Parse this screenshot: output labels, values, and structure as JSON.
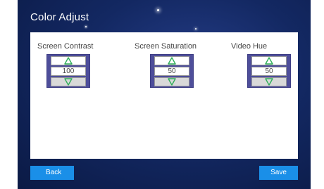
{
  "title": "Color Adjust",
  "controls": [
    {
      "label": "Screen Contrast",
      "value": "100",
      "up_icon": "chevron-up-outline-icon",
      "down_icon": "chevron-down-outline-icon"
    },
    {
      "label": "Screen Saturation",
      "value": "50",
      "up_icon": "chevron-up-outline-icon",
      "down_icon": "chevron-down-outline-icon"
    },
    {
      "label": "Video Hue",
      "value": "50",
      "up_icon": "chevron-up-outline-icon",
      "down_icon": "chevron-down-outline-icon"
    }
  ],
  "footer": {
    "back_label": "Back",
    "save_label": "Save"
  },
  "colors": {
    "background": "#132862",
    "spinner_frame": "#4e4e9a",
    "arrow": "#2fae5a",
    "button": "#1a8fe8"
  }
}
